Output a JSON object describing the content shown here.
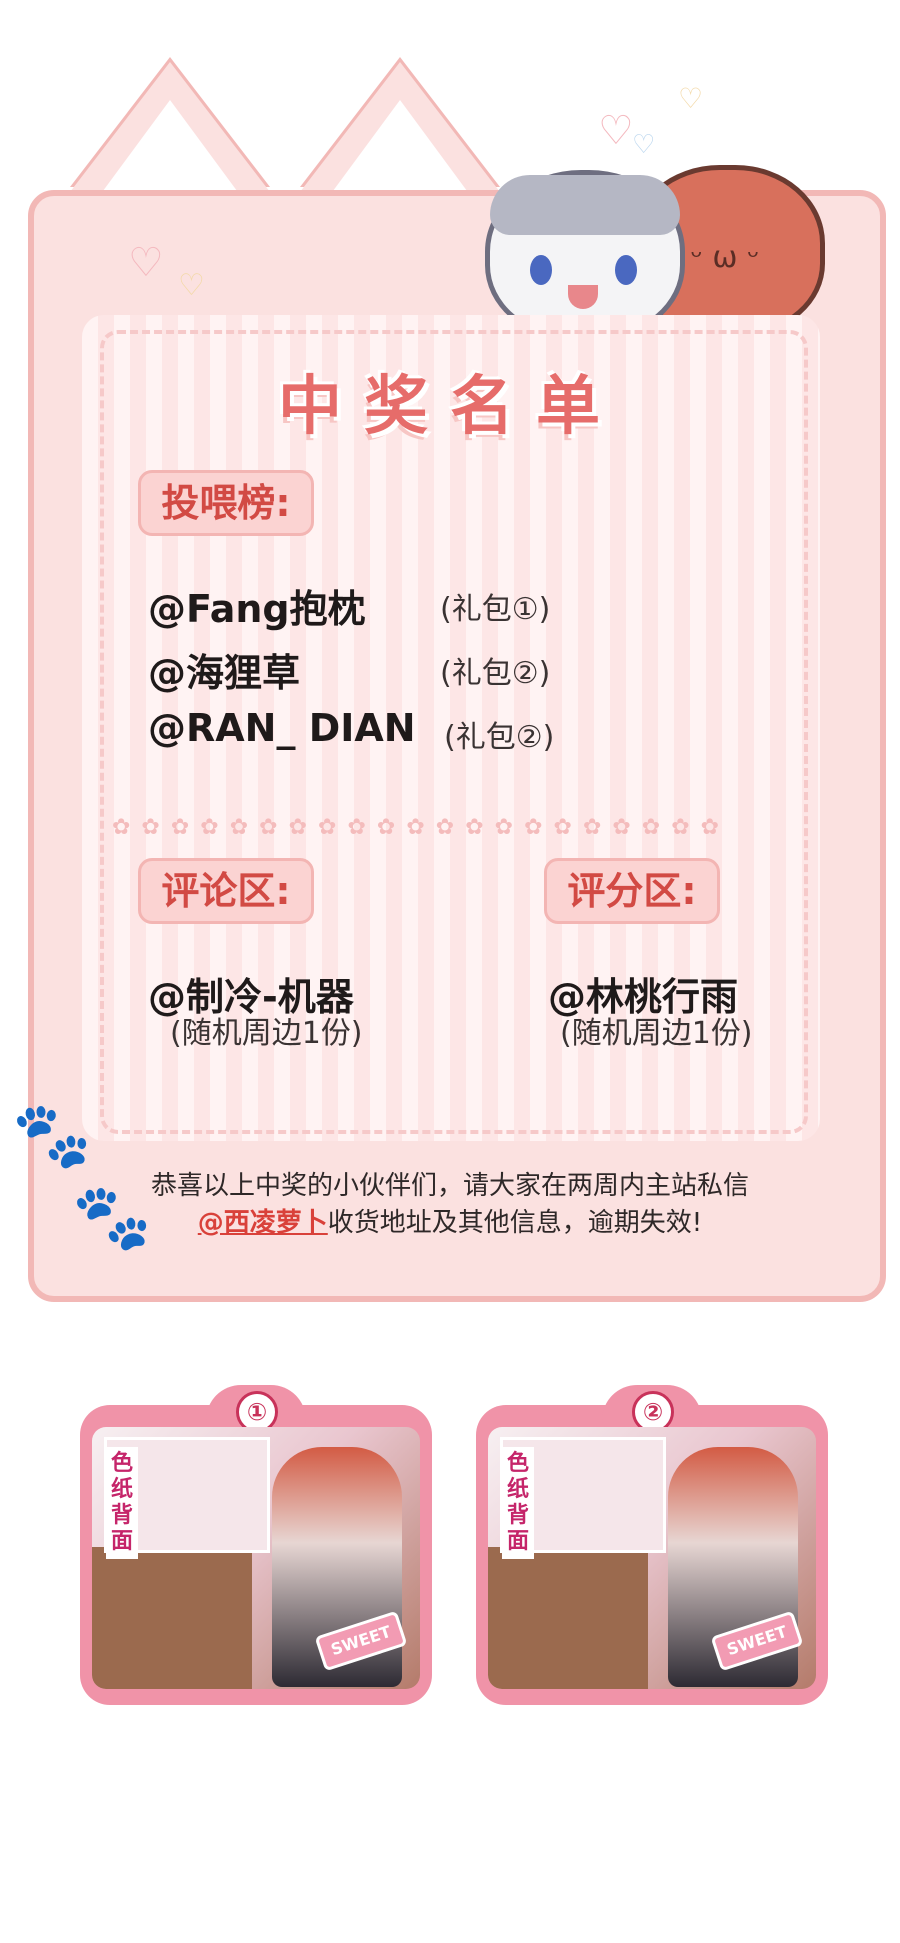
{
  "title": "中奖名单",
  "sections": {
    "feeding": {
      "label": "投喂榜:",
      "winners": [
        {
          "name": "@Fang抱枕",
          "gift": "(礼包①)"
        },
        {
          "name": "@海狸草",
          "gift": "(礼包②)"
        },
        {
          "name": "@RAN_ DIAN",
          "gift": "(礼包②)"
        }
      ]
    },
    "comments": {
      "label": "评论区:",
      "winner": "@制冷-机器",
      "prize": "(随机周边1份)"
    },
    "rating": {
      "label": "评分区:",
      "winner": "@林桃行雨",
      "prize": "(随机周边1份)"
    }
  },
  "footer": {
    "line1": "恭喜以上中奖的小伙伴们，请大家在两周内主站私信",
    "mention": "@西凌萝卜",
    "line2_rest": "收货地址及其他信息，逾期失效!"
  },
  "gift_packs": [
    {
      "number": "①",
      "side_label": "色纸背面",
      "sticker": "SWEET"
    },
    {
      "number": "②",
      "side_label": "色纸背面",
      "sticker": "SWEET"
    }
  ],
  "colors": {
    "card_bg": "#fbe1e0",
    "card_border": "#f2b8b6",
    "title": "#e66c6a",
    "tag_text": "#d24a44",
    "gift_frame": "#f093a8"
  },
  "icons": [
    "heart-icon",
    "paw-icon",
    "cat-mascot-gray",
    "cat-mascot-red"
  ]
}
